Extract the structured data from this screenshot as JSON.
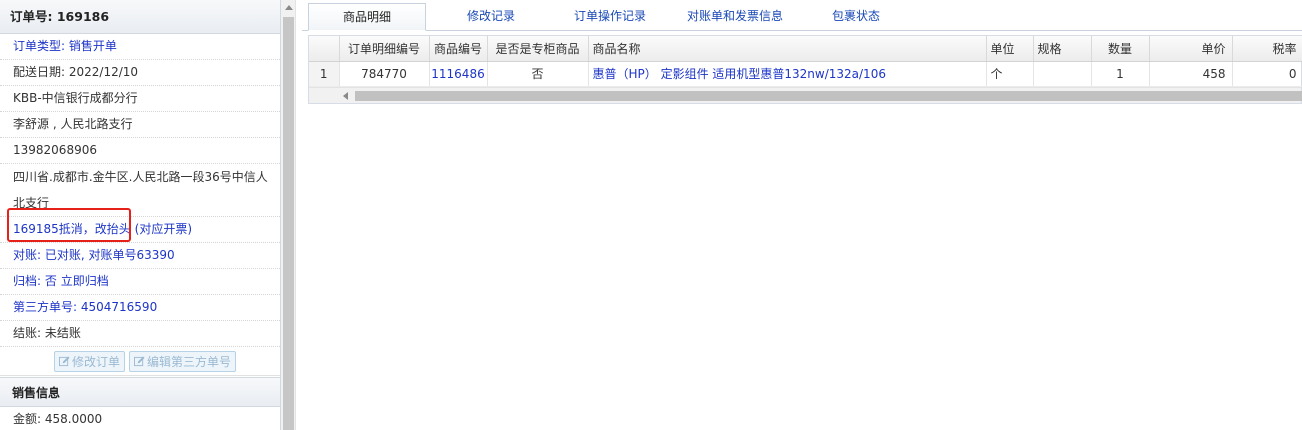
{
  "order": {
    "header_title": "订单号: 169186",
    "rows": {
      "type": "订单类型: 销售开单",
      "delivery_date": "配送日期: 2022/12/10",
      "customer": "KBB-中信银行成都分行",
      "contact": "李舒源 , 人民北路支行",
      "phone": "13982068906",
      "address": "四川省.成都市.金牛区.人民北路一段36号中信人北支行",
      "note": "169185抵消，改抬头",
      "note_link": "(对应开票)",
      "reconcile": "对账: 已对账, 对账单号63390",
      "archive_label": "归档: ",
      "archive_value": "否",
      "archive_link": "立即归档",
      "third_party": "第三方单号: 4504716590",
      "settle": "结账: 未结账"
    },
    "buttons": {
      "edit_order": "修改订单",
      "edit_third": "编辑第三方单号"
    }
  },
  "sales": {
    "header_title": "销售信息",
    "amount": "金额: 458.0000"
  },
  "tabs": [
    {
      "label": "商品明细",
      "active": true
    },
    {
      "label": "修改记录",
      "active": false
    },
    {
      "label": "订单操作记录",
      "active": false
    },
    {
      "label": "对账单和发票信息",
      "active": false
    },
    {
      "label": "包裹状态",
      "active": false
    }
  ],
  "grid": {
    "columns": [
      "",
      "订单明细编号",
      "商品编号",
      "是否是专柜商品",
      "商品名称",
      "单位",
      "规格",
      "数量",
      "单价",
      "税率"
    ],
    "rows": [
      [
        "1",
        "784770",
        "1116486",
        "否",
        "惠普（HP） 定影组件 适用机型惠普132nw/132a/106",
        "个",
        "",
        "1",
        "458",
        "0"
      ]
    ]
  },
  "colors": {
    "link_blue": "#1d35c7",
    "tab_blue": "#1a49b6",
    "highlight_red": "#e8201a",
    "button_text": "#9ab9d3"
  }
}
